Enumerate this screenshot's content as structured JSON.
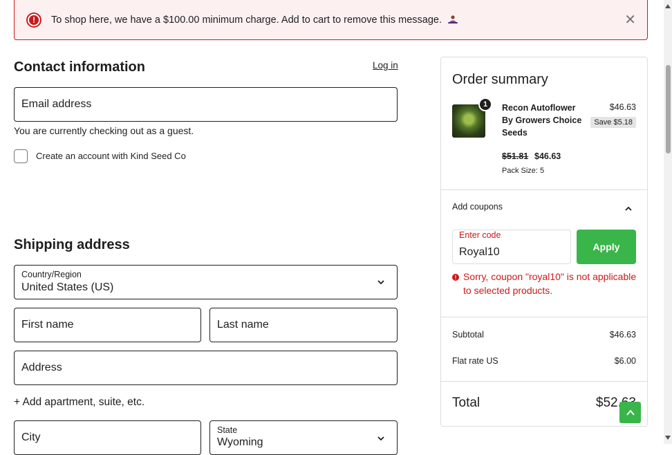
{
  "notice": {
    "message": "To shop here, we have a $100.00 minimum charge. Add to cart to remove this message.",
    "emoji_icon": "person-in-lotus-icon",
    "close_icon": "close-icon",
    "color": "#cc1818"
  },
  "contact": {
    "title": "Contact information",
    "login_label": "Log in",
    "email_placeholder": "Email address",
    "guest_text": "You are currently checking out as a guest.",
    "create_account_label": "Create an account with Kind Seed Co"
  },
  "shipping": {
    "title": "Shipping address",
    "country_label": "Country/Region",
    "country_value": "United States (US)",
    "first_name_placeholder": "First name",
    "last_name_placeholder": "Last name",
    "address_placeholder": "Address",
    "add_apartment": "+ Add apartment, suite, etc.",
    "city_placeholder": "City",
    "state_label": "State",
    "state_value": "Wyoming"
  },
  "summary": {
    "title": "Order summary",
    "item": {
      "quantity": "1",
      "name": "Recon Autoflower By Growers Choice Seeds",
      "price": "$46.63",
      "save": "Save $5.18",
      "old_price": "$51.81",
      "new_price": "$46.63",
      "pack_size": "Pack Size: 5"
    },
    "coupons_label": "Add coupons",
    "coupon_field_label": "Enter code",
    "coupon_value": "Royal10",
    "apply_label": "Apply",
    "coupon_error": "Sorry, coupon \"royal10\" is not applicable to selected products.",
    "subtotal_label": "Subtotal",
    "subtotal_value": "$46.63",
    "shipping_label": "Flat rate US",
    "shipping_value": "$6.00",
    "total_label": "Total",
    "total_value": "$52.63",
    "accent_color": "#3ab54a"
  }
}
